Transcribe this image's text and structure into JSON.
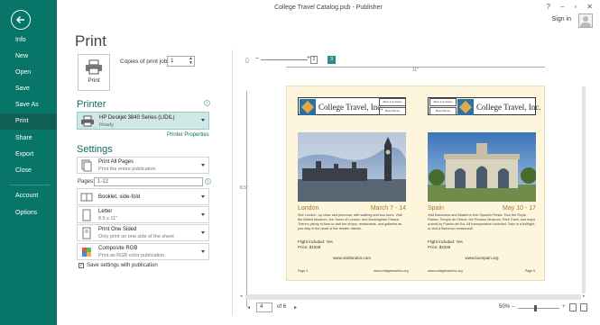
{
  "window": {
    "title": "College Travel Catalog.pub - Publisher",
    "controls": [
      "?",
      "–",
      "▫",
      "✕"
    ],
    "signin": "Sign in"
  },
  "nav": {
    "items": [
      {
        "label": "Info",
        "active": false
      },
      {
        "label": "New",
        "active": false
      },
      {
        "label": "Open",
        "active": false
      },
      {
        "label": "Save",
        "active": false
      },
      {
        "label": "Save As",
        "active": false
      },
      {
        "label": "Print",
        "active": true
      },
      {
        "label": "Share",
        "active": false
      },
      {
        "label": "Export",
        "active": false
      },
      {
        "label": "Close",
        "active": false
      },
      {
        "label": "Account",
        "active": false
      },
      {
        "label": "Options",
        "active": false
      }
    ]
  },
  "print": {
    "title": "Print",
    "button_label": "Print",
    "copies_label": "Copies of print job:",
    "copies_value": "1"
  },
  "printer": {
    "heading": "Printer",
    "name": "HP Deskjet 3840 Series (LIDIL)",
    "status": "Ready",
    "properties_link": "Printer Properties"
  },
  "settings": {
    "heading": "Settings",
    "print_all": {
      "title": "Print All Pages",
      "subtitle": "Print the entire publication"
    },
    "pages_label": "Pages:",
    "pages_value": "1-12",
    "booklet": "Booklet, side-fold",
    "paper": {
      "title": "Letter",
      "subtitle": "8.5 x 11\""
    },
    "sides": {
      "title": "Print One Sided",
      "subtitle": "Only print on one side of the sheet"
    },
    "color": {
      "title": "Composite RGB",
      "subtitle": "Print as RGB color publication."
    },
    "save_with_pub": "Save settings with publication"
  },
  "preview": {
    "page_btn_1": "2",
    "page_btn_2": "3",
    "ruler_h_label": "11\"",
    "ruler_v_label": "8.5\"",
    "left": {
      "brand": "College Travel, Inc.",
      "mini1": "Best Locations",
      "mini2": "Best Prices",
      "city": "London",
      "date": "March 7 - 14",
      "desc": "See London, up close and personal, with walking and bus tours. Visit the British Museum, the Tower of London, and Buckingham Palace. There's plenty of time to visit the shops, restaurants, and galleries as you stay in the heart of the theater district.",
      "flight": "Flight included: Yes",
      "price": "Price: $1938",
      "url": "www.visitlondon.com",
      "foot_left": "Page 4",
      "foot_right": "www.collegetravelinc.org"
    },
    "right": {
      "brand": "College Travel, Inc.",
      "mini1": "Best Locations",
      "mini2": "Best Prices",
      "city": "Spain",
      "date": "May 10 - 17",
      "desc": "Visit Barcelona and Madrid in this Spanish Fiesta. Tour the Royal Palace, Templo de Debod, the Picasso Museum, Park Guell, and enjoy a stroll by Puerta del Sol. All transportation included. Take in a bullfight, or visit a flamenco restaurant!",
      "flight": "Flight included: Yes",
      "price": "Price: $2348",
      "url": "www.tourspain.org",
      "foot_left": "www.collegetravelinc.org",
      "foot_right": "Page 5"
    }
  },
  "status": {
    "current_page": "4",
    "of_pages": "of 6",
    "zoom": "50%"
  },
  "colors": {
    "nav_bg": "#077568",
    "accent": "#0e6e63",
    "sheet_bg": "#fdf6dc",
    "date_color": "#a3772f"
  }
}
